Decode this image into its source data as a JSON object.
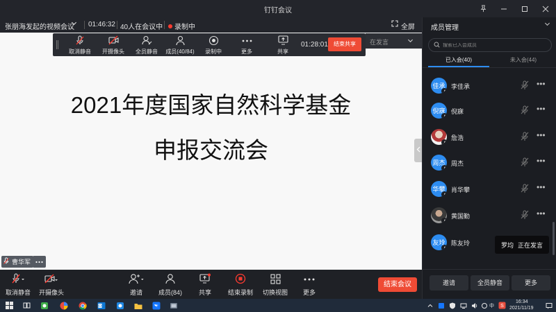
{
  "window": {
    "title": "钉钉会议"
  },
  "infobar": {
    "meeting_title": "张朋海发起的视频会议",
    "elapsed": "01:46:32",
    "participants": "40人在会议中",
    "recording": "录制中",
    "fullscreen": "全屏"
  },
  "slide": {
    "line1": "2021年度国家自然科学基金",
    "line2": "申报交流会"
  },
  "share_toolbar": {
    "unmute": "取消静音",
    "camera": "开摄像头",
    "mute_all": "全员静音",
    "members": "成员(40/84)",
    "recording": "录制中",
    "more": "更多",
    "share": "共享",
    "timer": "01:28:01",
    "stop_share": "结束共享",
    "speaking_behind": "在发言"
  },
  "presenter_chip": {
    "name": "曹华军"
  },
  "bottom_toolbar": {
    "unmute": "取消静音",
    "camera": "开摄像头",
    "invite": "邀请",
    "members": "成员(84)",
    "share": "共享",
    "stop_recording": "结束录制",
    "switch_view": "切换视图",
    "more": "更多",
    "end_meeting": "结束会议"
  },
  "panel": {
    "title": "成员管理",
    "search_placeholder": "搜索已入会成员",
    "tab_joined": "已入会(40)",
    "tab_not_joined": "未入会(44)",
    "members": [
      {
        "avatar_text": "佳承",
        "name": "李佳承",
        "avatar": "blue"
      },
      {
        "avatar_text": "倪寐",
        "name": "倪寐",
        "avatar": "blue"
      },
      {
        "avatar_text": "",
        "name": "詹浩",
        "avatar": "photo1"
      },
      {
        "avatar_text": "周杰",
        "name": "周杰",
        "avatar": "blue"
      },
      {
        "avatar_text": "华攀",
        "name": "肖华攀",
        "avatar": "blue"
      },
      {
        "avatar_text": "",
        "name": "黄国勤",
        "avatar": "photo2"
      },
      {
        "avatar_text": "友玲",
        "name": "陈友玲",
        "avatar": "blue"
      }
    ],
    "invite": "邀请",
    "mute_all": "全员静音",
    "more": "更多"
  },
  "toast": {
    "name": "罗均",
    "status": "正在发言"
  },
  "taskbar": {
    "time": "16:34",
    "date": "2021/11/19",
    "ime": "中"
  },
  "colors": {
    "accent_blue": "#2d8cf0",
    "end_red": "#ef4b35",
    "record_red": "#ff3b30"
  }
}
